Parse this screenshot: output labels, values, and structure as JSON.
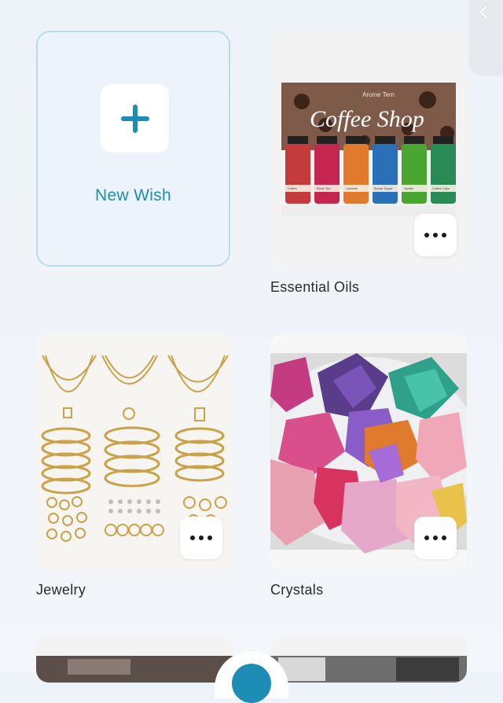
{
  "new_wish": {
    "label": "New Wish"
  },
  "wishlists": [
    {
      "label": "Essential Oils",
      "image": {
        "brand": "Arome Tem",
        "title": "Coffee Shop",
        "bottles": [
          "Coffee",
          "Black Tea",
          "Caramel",
          "Brown Sugar",
          "Vanilla",
          "Coffee Cake"
        ]
      }
    },
    {
      "label": "Jewelry"
    },
    {
      "label": "Crystals"
    }
  ],
  "icons": {
    "back": "chevron-left-icon",
    "add": "plus-icon",
    "more": "more-horizontal-icon"
  },
  "colors": {
    "accent": "#1f8eb3",
    "new_wish_border": "#b9dce9",
    "background": "#eef3f9"
  }
}
